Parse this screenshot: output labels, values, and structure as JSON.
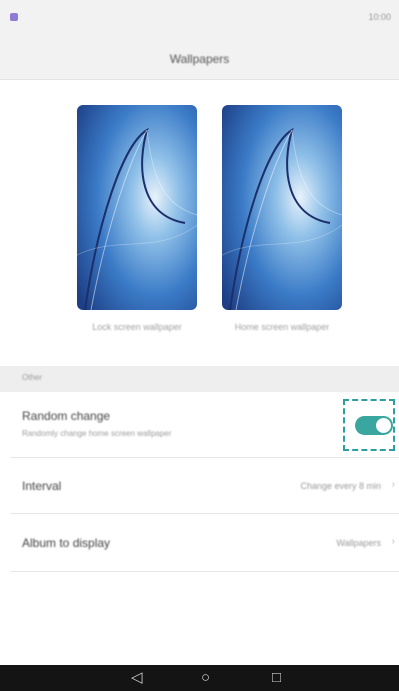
{
  "status_bar": {
    "app_icon": "app-notification-icon",
    "right_text": "10:00"
  },
  "header": {
    "title": "Wallpapers"
  },
  "wallpapers": {
    "lock_label": "Lock screen wallpaper",
    "home_label": "Home screen wallpaper"
  },
  "section": {
    "title": "Other"
  },
  "settings": {
    "random_change": {
      "title": "Random change",
      "subtitle": "Randomly change home screen wallpaper",
      "enabled": true
    },
    "interval": {
      "title": "Interval",
      "value": "Change every 8 min"
    },
    "album": {
      "title": "Album to display",
      "value": "Wallpapers"
    }
  },
  "nav": {
    "back_icon": "back-icon",
    "home_icon": "home-icon",
    "recents_icon": "recents-icon"
  },
  "colors": {
    "accent": "#3aa6a0",
    "app_icon": "#8f7bd6"
  }
}
